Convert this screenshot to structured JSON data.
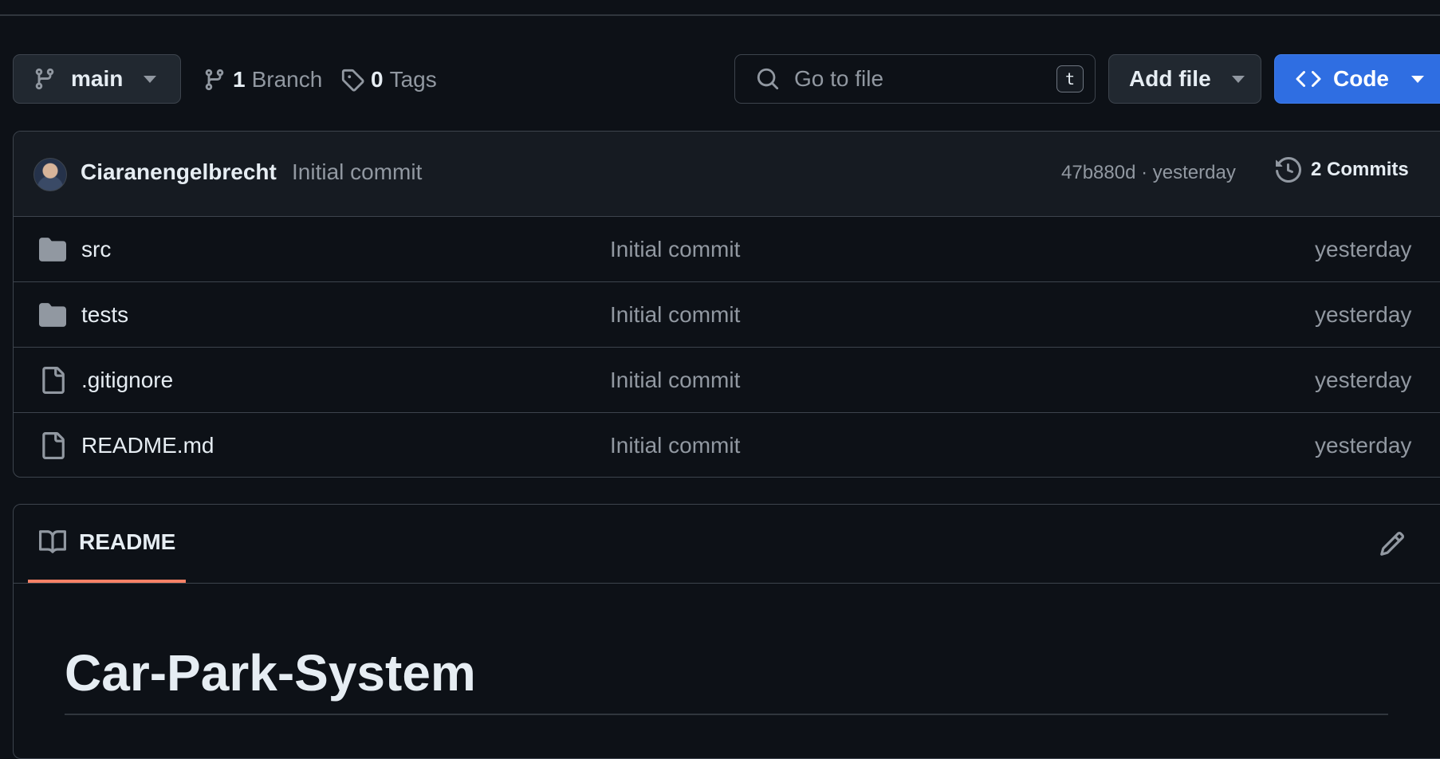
{
  "toolbar": {
    "branch_selector": "main",
    "branches_count": "1",
    "branches_label": "Branch",
    "tags_count": "0",
    "tags_label": "Tags",
    "search_placeholder": "Go to file",
    "search_shortcut": "t",
    "add_file_label": "Add file",
    "code_label": "Code",
    "code_button_color": "#2f6ee2"
  },
  "latest_commit": {
    "author": "Ciaranengelbrecht",
    "message": "Initial commit",
    "hash_and_time": "47b880d · yesterday",
    "commits_label": "2 Commits"
  },
  "files": [
    {
      "type": "folder",
      "name": "src",
      "message": "Initial commit",
      "date": "yesterday"
    },
    {
      "type": "folder",
      "name": "tests",
      "message": "Initial commit",
      "date": "yesterday"
    },
    {
      "type": "file",
      "name": ".gitignore",
      "message": "Initial commit",
      "date": "yesterday"
    },
    {
      "type": "file",
      "name": "README.md",
      "message": "Initial commit",
      "date": "yesterday"
    }
  ],
  "readme": {
    "tab_label": "README",
    "title": "Car-Park-System",
    "tab_accent_color": "#f78166"
  }
}
